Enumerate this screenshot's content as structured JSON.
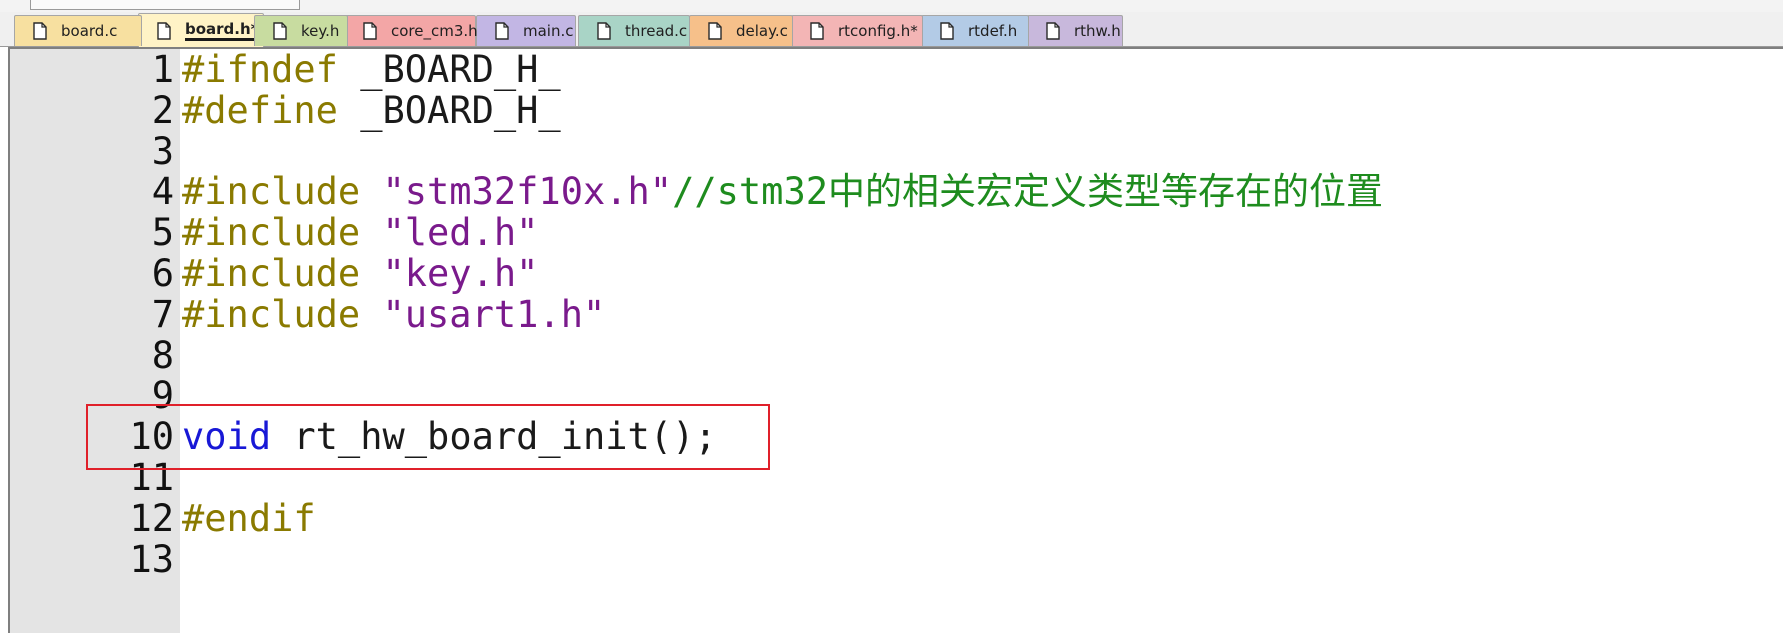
{
  "tabs": [
    {
      "label": "board.c",
      "color": "#f7e0a0",
      "active": false
    },
    {
      "label": "board.h*",
      "color": "#fff3c6",
      "active": true
    },
    {
      "label": "key.h",
      "color": "#c8dca0",
      "active": false
    },
    {
      "label": "core_cm3.h",
      "color": "#f3a6a6",
      "active": false
    },
    {
      "label": "main.c",
      "color": "#c2b6e4",
      "active": false
    },
    {
      "label": "thread.c",
      "color": "#a9d4c6",
      "active": false
    },
    {
      "label": "delay.c",
      "color": "#f6c08a",
      "active": false
    },
    {
      "label": "rtconfig.h*",
      "color": "#f3b5b5",
      "active": false
    },
    {
      "label": "rtdef.h",
      "color": "#b3cbe6",
      "active": false
    },
    {
      "label": "rthw.h",
      "color": "#c8b8dc",
      "active": false
    }
  ],
  "editor": {
    "lines": [
      {
        "num": "1",
        "tokens": [
          {
            "t": "#ifndef ",
            "c": "pre"
          },
          {
            "t": "_BOARD_H_",
            "c": "id"
          }
        ]
      },
      {
        "num": "2",
        "tokens": [
          {
            "t": "#define ",
            "c": "pre"
          },
          {
            "t": "_BOARD_H_",
            "c": "id"
          }
        ]
      },
      {
        "num": "3",
        "tokens": []
      },
      {
        "num": "4",
        "tokens": [
          {
            "t": "#include ",
            "c": "pre"
          },
          {
            "t": "\"stm32f10x.h\"",
            "c": "str"
          },
          {
            "t": "//stm32中的相关宏定义类型等存在的位置",
            "c": "cmt"
          }
        ]
      },
      {
        "num": "5",
        "tokens": [
          {
            "t": "#include ",
            "c": "pre"
          },
          {
            "t": "\"led.h\"",
            "c": "str"
          }
        ]
      },
      {
        "num": "6",
        "tokens": [
          {
            "t": "#include ",
            "c": "pre"
          },
          {
            "t": "\"key.h\"",
            "c": "str"
          }
        ]
      },
      {
        "num": "7",
        "tokens": [
          {
            "t": "#include ",
            "c": "pre"
          },
          {
            "t": "\"usart1.h\"",
            "c": "str"
          }
        ]
      },
      {
        "num": "8",
        "tokens": []
      },
      {
        "num": "9",
        "tokens": []
      },
      {
        "num": "10",
        "tokens": [
          {
            "t": "void",
            "c": "kw"
          },
          {
            "t": " rt_hw_board_init();",
            "c": "id"
          }
        ]
      },
      {
        "num": "11",
        "tokens": []
      },
      {
        "num": "12",
        "tokens": [
          {
            "t": "#endif",
            "c": "pre"
          }
        ]
      },
      {
        "num": "13",
        "tokens": []
      }
    ],
    "highlighted_line": "10",
    "highlight_color": "#e0202a"
  },
  "colors": {
    "preprocessor": "#8a7a00",
    "string": "#7a1a8c",
    "comment": "#1e8c1e",
    "keyword": "#1818d6",
    "gutter": "#e4e4e4"
  },
  "icons": {
    "tab_file": "document-icon"
  }
}
